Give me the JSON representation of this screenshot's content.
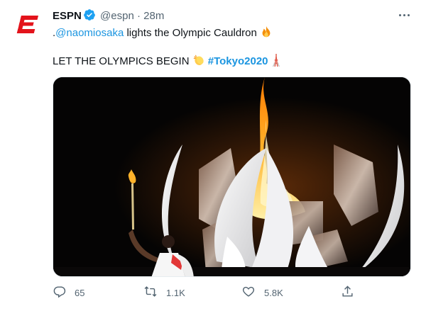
{
  "author": {
    "name": "ESPN",
    "handle": "@espn",
    "separator": "·",
    "time": "28m",
    "brand_color": "#e3131b"
  },
  "tweet": {
    "line1_prefix": ".",
    "mention": "@naomiosaka",
    "line1_rest": " lights the Olympic Cauldron",
    "line1_emoji": "fire",
    "line2_text": "LET THE OLYMPICS BEGIN",
    "line2_emoji": "clapping-hands",
    "hashtag": "#Tokyo2020",
    "line2_trailing_emoji": "tokyo-tower"
  },
  "actions": {
    "reply_count": "65",
    "retweet_count": "1.1K",
    "like_count": "5.8K"
  },
  "icons": [
    "espn-logo-icon",
    "verified-icon",
    "more-icon",
    "fire-emoji-icon",
    "clap-emoji-icon",
    "tokyo-tower-icon",
    "reply-icon",
    "retweet-icon",
    "like-icon",
    "share-icon"
  ],
  "colors": {
    "link": "#1b95e0",
    "secondary_text": "#536471",
    "verified": "#1da1f2"
  }
}
